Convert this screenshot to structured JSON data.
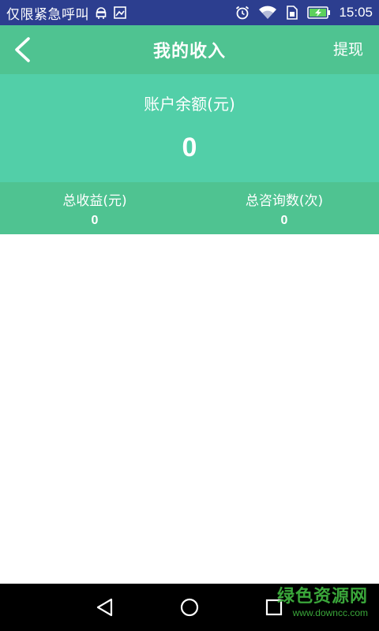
{
  "status_bar": {
    "carrier_text": "仅限紧急呼叫",
    "time": "15:05",
    "icons": [
      "android-debug-icon",
      "image-icon",
      "alarm-icon",
      "wifi-icon",
      "sim-icon",
      "battery-charging-icon"
    ]
  },
  "app_bar": {
    "back_icon": "chevron-left-icon",
    "title": "我的收入",
    "action_label": "提现"
  },
  "balance": {
    "label": "账户余额(元)",
    "value": "0"
  },
  "stats": [
    {
      "label": "总收益(元)",
      "value": "0"
    },
    {
      "label": "总咨询数(次)",
      "value": "0"
    }
  ],
  "nav_bar": {
    "icons": [
      "triangle-back-icon",
      "circle-home-icon",
      "square-recents-icon"
    ]
  },
  "watermark": {
    "main": "绿色资源网",
    "url": "www.downcc.com"
  },
  "colors": {
    "status_bar": "#2c3e8f",
    "app_bar": "#4fc391",
    "balance_panel": "#52cfa8",
    "stats_row": "#4fc391",
    "nav_bar": "#000000",
    "watermark": "#3aa63a"
  }
}
